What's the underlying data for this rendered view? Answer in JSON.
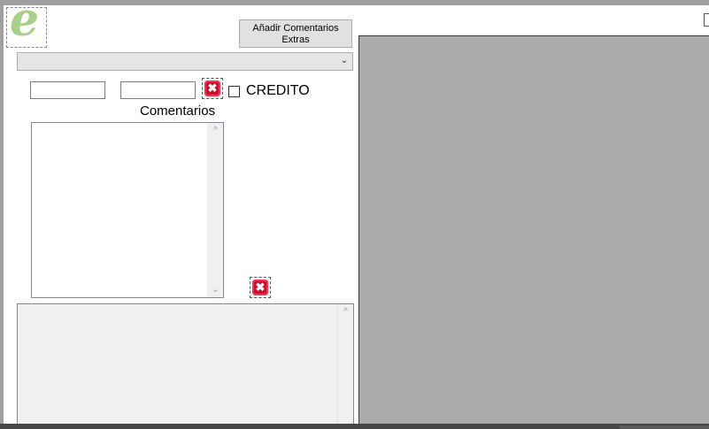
{
  "logo": {
    "glyph": "e"
  },
  "buttons": {
    "extras_label": "Añadir Comentarios Extras",
    "close_glyph": "✖"
  },
  "combo": {
    "value": "",
    "arrow": "⌄"
  },
  "fields": {
    "field1": "",
    "field2": ""
  },
  "checkbox": {
    "label": "CREDITO",
    "checked": false
  },
  "labels": {
    "comentarios": "Comentarios"
  },
  "scroll": {
    "up": "^",
    "down": "⌄"
  },
  "colors": {
    "logo_green": "#a9cf8b",
    "close_red": "#c8102e",
    "canvas_gray": "#ababab"
  }
}
